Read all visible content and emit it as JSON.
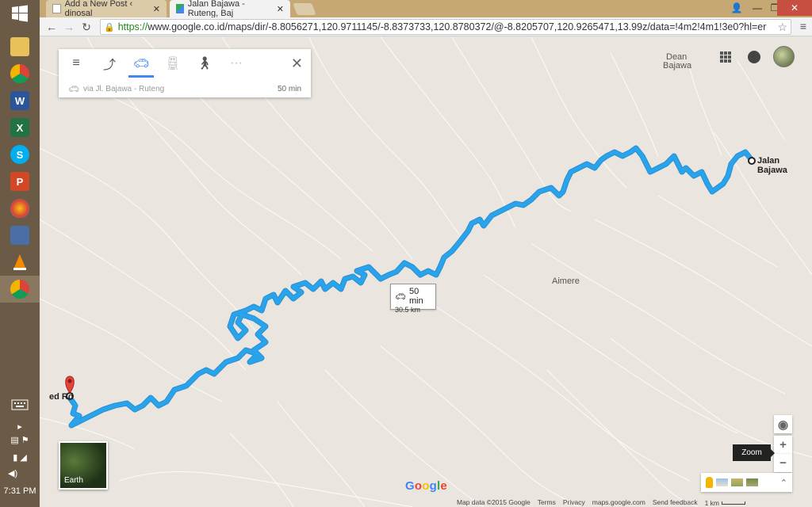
{
  "browser": {
    "tabs": [
      {
        "title": "Add a New Post ‹ dinosal",
        "active": false
      },
      {
        "title": "Jalan Bajawa - Ruteng, Baj",
        "active": true
      }
    ],
    "url_https": "https://",
    "url_rest": "www.google.co.id/maps/dir/-8.8056271,120.9711145/-8.8373733,120.8780372/@-8.8205707,120.9265471,13.99z/data=!4m2!4m1!3e0?hl=er",
    "window_controls": [
      "minimize",
      "maximize",
      "close"
    ],
    "nav": [
      "back-icon",
      "forward-icon",
      "reload-icon"
    ]
  },
  "taskbar": {
    "apps": [
      "explorer",
      "chrome",
      "word",
      "excel",
      "skype",
      "powerpoint",
      "balloon",
      "network",
      "vlc",
      "chrome"
    ],
    "clock": "7:31 PM"
  },
  "directions": {
    "modes": [
      "menu-icon",
      "directions-icon",
      "car-icon",
      "transit-icon",
      "walk-icon",
      "more-icon"
    ],
    "selected_mode": "car-icon",
    "route_via": "via Jl. Bajawa - Ruteng",
    "route_duration": "50 min"
  },
  "map": {
    "places": {
      "bajawa": "Bajawa",
      "dean": "Dean",
      "aimere": "Aimere"
    },
    "callout": {
      "duration": "50 min",
      "distance": "30.5 km"
    },
    "start_label": "Jalan Bajawa",
    "end_label": "ed Rd",
    "earth_label": "Earth",
    "zoom_tooltip": "Zoom",
    "route_color": "#29a3ec",
    "logo": "Google"
  },
  "footer": {
    "map_data": "Map data ©2015 Google",
    "terms": "Terms",
    "privacy": "Privacy",
    "site": "maps.google.com",
    "feedback": "Send feedback",
    "scale": "1 km"
  }
}
